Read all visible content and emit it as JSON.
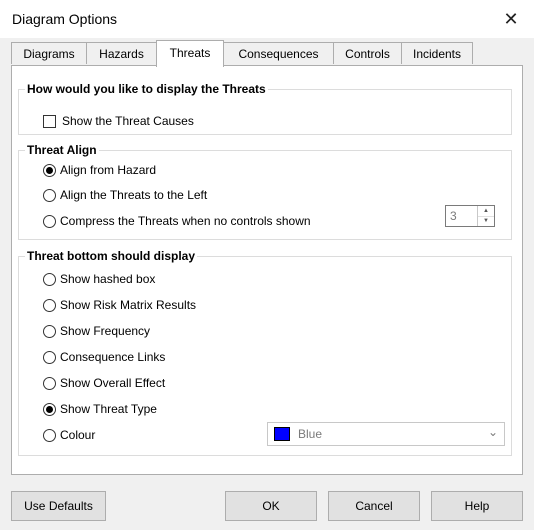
{
  "window": {
    "title": "Diagram Options",
    "close_glyph": "✕"
  },
  "tabs": [
    {
      "label": "Diagrams"
    },
    {
      "label": "Hazards"
    },
    {
      "label": "Threats"
    },
    {
      "label": "Consequences"
    },
    {
      "label": "Controls"
    },
    {
      "label": "Incidents"
    }
  ],
  "active_tab": "Threats",
  "display_group": {
    "title": "How would you like to display the Threats",
    "show_causes": {
      "label": "Show the Threat Causes",
      "checked": false
    }
  },
  "align_group": {
    "title": "Threat Align",
    "options": [
      {
        "label": "Align from Hazard",
        "selected": true
      },
      {
        "label": "Align the Threats to the Left",
        "selected": false
      },
      {
        "label": "Compress the Threats when no controls shown",
        "selected": false
      }
    ],
    "spinner_value": "3"
  },
  "bottom_group": {
    "title": "Threat bottom should display",
    "options": [
      {
        "label": "Show hashed box",
        "selected": false
      },
      {
        "label": "Show Risk Matrix Results",
        "selected": false
      },
      {
        "label": "Show Frequency",
        "selected": false
      },
      {
        "label": "Consequence Links",
        "selected": false
      },
      {
        "label": "Show Overall Effect",
        "selected": false
      },
      {
        "label": "Show Threat Type",
        "selected": true
      },
      {
        "label": "Colour",
        "selected": false
      }
    ],
    "colour_combo": {
      "value": "Blue",
      "swatch": "#0000ff"
    }
  },
  "buttons": {
    "use_defaults": "Use Defaults",
    "ok": "OK",
    "cancel": "Cancel",
    "help": "Help"
  }
}
